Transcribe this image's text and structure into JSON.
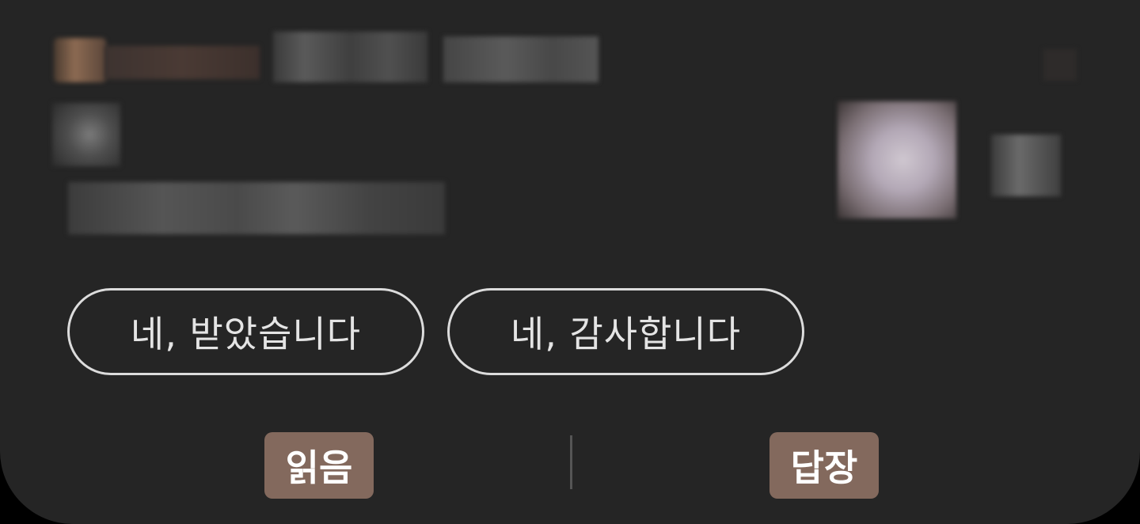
{
  "notification": {
    "quick_replies": [
      {
        "label": "네, 받았습니다"
      },
      {
        "label": "네, 감사합니다"
      }
    ],
    "actions": {
      "read_label": "읽음",
      "reply_label": "답장"
    }
  },
  "colors": {
    "card_background": "#252525",
    "action_highlight": "#83695d",
    "chip_border": "#dcdcdc"
  }
}
